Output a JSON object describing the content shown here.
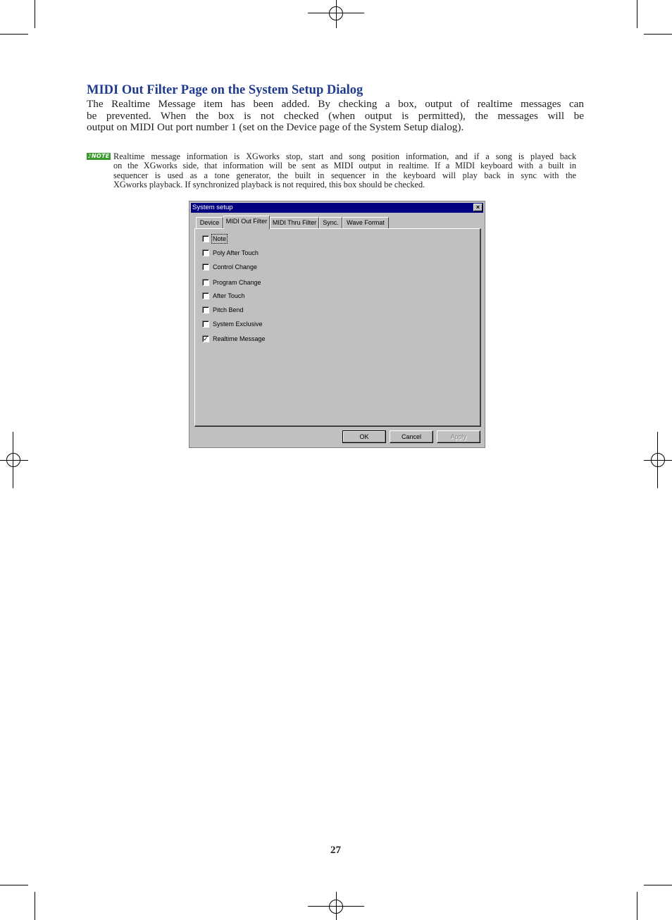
{
  "heading": "MIDI Out Filter Page on the System Setup Dialog",
  "body_lines": [
    "The Realtime Message item has been added. By checking a box, output of realtime messages can",
    "be prevented. When the box is not checked (when output is permitted), the messages will be",
    "output on MIDI Out port number 1 (set on the Device page of the System Setup dialog)."
  ],
  "note": {
    "badge": "NOTE",
    "lines": [
      "Realtime message information is XGworks stop, start and song position information, and if a song is played back",
      "on the XGworks side, that information will be sent as MIDI output in realtime. If a MIDI keyboard with a built in",
      "sequencer is used as a tone generator, the built in sequencer in the keyboard will play back in sync with the",
      "XGworks playback. If synchronized playback is not required, this box should be checked."
    ]
  },
  "dialog": {
    "title": "System setup",
    "close_glyph": "×",
    "tabs": [
      {
        "label": "Device",
        "active": false
      },
      {
        "label": "MIDI Out Filter",
        "active": true
      },
      {
        "label": "MIDI Thru Filter",
        "active": false
      },
      {
        "label": "Sync.",
        "active": false
      },
      {
        "label": "Wave Format",
        "active": false
      }
    ],
    "checkboxes": [
      {
        "label": "Note",
        "checked": false
      },
      {
        "label": "Poly After Touch",
        "checked": false
      },
      {
        "label": "Control Change",
        "checked": false
      },
      {
        "label": "Program Change",
        "checked": false
      },
      {
        "label": "After Touch",
        "checked": false
      },
      {
        "label": "Pitch Bend",
        "checked": false
      },
      {
        "label": "System Exclusive",
        "checked": false
      },
      {
        "label": "Realtime Message",
        "checked": true
      }
    ],
    "check_mark": "✓",
    "buttons": {
      "ok": "OK",
      "cancel": "Cancel",
      "apply": "Apply"
    }
  },
  "page_number": "27"
}
